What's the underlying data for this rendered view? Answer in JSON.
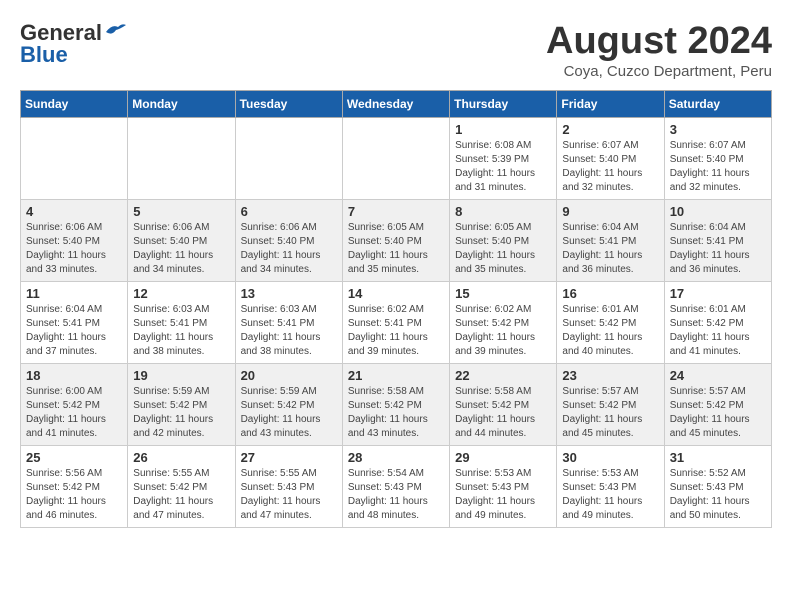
{
  "header": {
    "logo_general": "General",
    "logo_blue": "Blue",
    "month_year": "August 2024",
    "location": "Coya, Cuzco Department, Peru"
  },
  "weekdays": [
    "Sunday",
    "Monday",
    "Tuesday",
    "Wednesday",
    "Thursday",
    "Friday",
    "Saturday"
  ],
  "weeks": [
    [
      {
        "day": "",
        "info": ""
      },
      {
        "day": "",
        "info": ""
      },
      {
        "day": "",
        "info": ""
      },
      {
        "day": "",
        "info": ""
      },
      {
        "day": "1",
        "info": "Sunrise: 6:08 AM\nSunset: 5:39 PM\nDaylight: 11 hours and 31 minutes."
      },
      {
        "day": "2",
        "info": "Sunrise: 6:07 AM\nSunset: 5:40 PM\nDaylight: 11 hours and 32 minutes."
      },
      {
        "day": "3",
        "info": "Sunrise: 6:07 AM\nSunset: 5:40 PM\nDaylight: 11 hours and 32 minutes."
      }
    ],
    [
      {
        "day": "4",
        "info": "Sunrise: 6:06 AM\nSunset: 5:40 PM\nDaylight: 11 hours and 33 minutes."
      },
      {
        "day": "5",
        "info": "Sunrise: 6:06 AM\nSunset: 5:40 PM\nDaylight: 11 hours and 34 minutes."
      },
      {
        "day": "6",
        "info": "Sunrise: 6:06 AM\nSunset: 5:40 PM\nDaylight: 11 hours and 34 minutes."
      },
      {
        "day": "7",
        "info": "Sunrise: 6:05 AM\nSunset: 5:40 PM\nDaylight: 11 hours and 35 minutes."
      },
      {
        "day": "8",
        "info": "Sunrise: 6:05 AM\nSunset: 5:40 PM\nDaylight: 11 hours and 35 minutes."
      },
      {
        "day": "9",
        "info": "Sunrise: 6:04 AM\nSunset: 5:41 PM\nDaylight: 11 hours and 36 minutes."
      },
      {
        "day": "10",
        "info": "Sunrise: 6:04 AM\nSunset: 5:41 PM\nDaylight: 11 hours and 36 minutes."
      }
    ],
    [
      {
        "day": "11",
        "info": "Sunrise: 6:04 AM\nSunset: 5:41 PM\nDaylight: 11 hours and 37 minutes."
      },
      {
        "day": "12",
        "info": "Sunrise: 6:03 AM\nSunset: 5:41 PM\nDaylight: 11 hours and 38 minutes."
      },
      {
        "day": "13",
        "info": "Sunrise: 6:03 AM\nSunset: 5:41 PM\nDaylight: 11 hours and 38 minutes."
      },
      {
        "day": "14",
        "info": "Sunrise: 6:02 AM\nSunset: 5:41 PM\nDaylight: 11 hours and 39 minutes."
      },
      {
        "day": "15",
        "info": "Sunrise: 6:02 AM\nSunset: 5:42 PM\nDaylight: 11 hours and 39 minutes."
      },
      {
        "day": "16",
        "info": "Sunrise: 6:01 AM\nSunset: 5:42 PM\nDaylight: 11 hours and 40 minutes."
      },
      {
        "day": "17",
        "info": "Sunrise: 6:01 AM\nSunset: 5:42 PM\nDaylight: 11 hours and 41 minutes."
      }
    ],
    [
      {
        "day": "18",
        "info": "Sunrise: 6:00 AM\nSunset: 5:42 PM\nDaylight: 11 hours and 41 minutes."
      },
      {
        "day": "19",
        "info": "Sunrise: 5:59 AM\nSunset: 5:42 PM\nDaylight: 11 hours and 42 minutes."
      },
      {
        "day": "20",
        "info": "Sunrise: 5:59 AM\nSunset: 5:42 PM\nDaylight: 11 hours and 43 minutes."
      },
      {
        "day": "21",
        "info": "Sunrise: 5:58 AM\nSunset: 5:42 PM\nDaylight: 11 hours and 43 minutes."
      },
      {
        "day": "22",
        "info": "Sunrise: 5:58 AM\nSunset: 5:42 PM\nDaylight: 11 hours and 44 minutes."
      },
      {
        "day": "23",
        "info": "Sunrise: 5:57 AM\nSunset: 5:42 PM\nDaylight: 11 hours and 45 minutes."
      },
      {
        "day": "24",
        "info": "Sunrise: 5:57 AM\nSunset: 5:42 PM\nDaylight: 11 hours and 45 minutes."
      }
    ],
    [
      {
        "day": "25",
        "info": "Sunrise: 5:56 AM\nSunset: 5:42 PM\nDaylight: 11 hours and 46 minutes."
      },
      {
        "day": "26",
        "info": "Sunrise: 5:55 AM\nSunset: 5:42 PM\nDaylight: 11 hours and 47 minutes."
      },
      {
        "day": "27",
        "info": "Sunrise: 5:55 AM\nSunset: 5:43 PM\nDaylight: 11 hours and 47 minutes."
      },
      {
        "day": "28",
        "info": "Sunrise: 5:54 AM\nSunset: 5:43 PM\nDaylight: 11 hours and 48 minutes."
      },
      {
        "day": "29",
        "info": "Sunrise: 5:53 AM\nSunset: 5:43 PM\nDaylight: 11 hours and 49 minutes."
      },
      {
        "day": "30",
        "info": "Sunrise: 5:53 AM\nSunset: 5:43 PM\nDaylight: 11 hours and 49 minutes."
      },
      {
        "day": "31",
        "info": "Sunrise: 5:52 AM\nSunset: 5:43 PM\nDaylight: 11 hours and 50 minutes."
      }
    ]
  ]
}
